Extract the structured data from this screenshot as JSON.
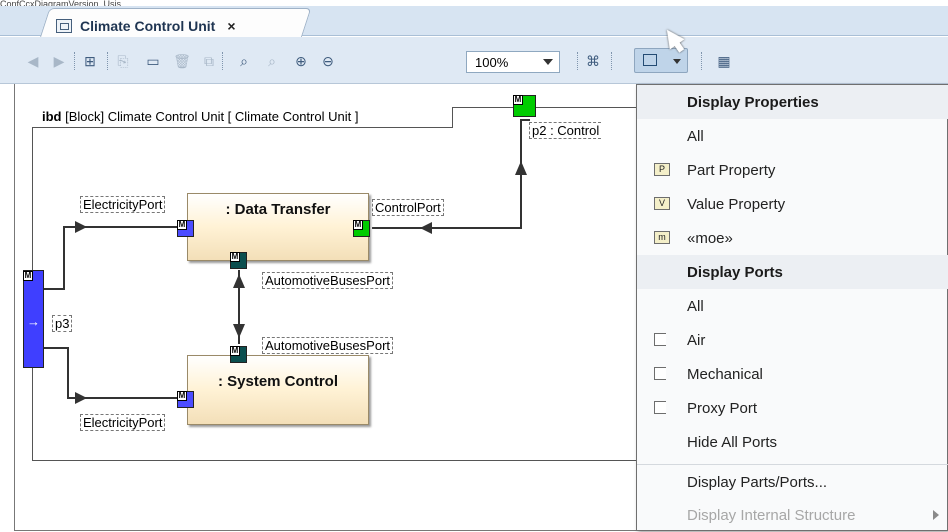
{
  "caption": "ConfCcxDiagramVersion, Usis",
  "tab": {
    "title": "Climate Control Unit",
    "close": "×"
  },
  "toolbar": {
    "zoom": "100%",
    "icons": [
      "back-icon",
      "forward-icon",
      "hierarchy-icon",
      "copy-icon",
      "paste-icon",
      "delete-icon",
      "duplicate-icon",
      "zoom-icon",
      "zoom-fit-icon",
      "zoom-in-icon",
      "zoom-out-icon",
      "layout-icon",
      "display-icon",
      "dropdown-icon",
      "table-icon"
    ]
  },
  "diagram": {
    "frame_kind": "ibd",
    "frame_title": "[Block] Climate Control Unit [ Climate Control Unit ]",
    "blocks": [
      {
        "name": ": Data Transfer"
      },
      {
        "name": ": System Control"
      }
    ],
    "labels": {
      "electricity_top": "ElectricityPort",
      "control_port": "ControlPort",
      "automotive_top": "AutomotiveBusesPort",
      "automotive_bottom": "AutomotiveBusesPort",
      "electricity_bottom": "ElectricityPort",
      "p3": "p3",
      "p2": "p2 : Control"
    },
    "badge": "M"
  },
  "menu": {
    "header1": "Display Properties",
    "item_all_1": "All",
    "part_property": "Part Property",
    "value_property": "Value Property",
    "moe": "«moe»",
    "header2": "Display Ports",
    "item_all_2": "All",
    "air": "Air",
    "mechanical": "Mechanical",
    "proxy_port": "Proxy Port",
    "hide_all_ports": "Hide All Ports",
    "display_parts_ports": "Display Parts/Ports...",
    "display_internal_structure": "Display Internal Structure",
    "icons": {
      "part": "P",
      "value": "V",
      "moe": "m"
    }
  },
  "colors": {
    "accent": "#3f3fff",
    "port_green": "#00cc00",
    "port_dark": "#0b4f4f",
    "block_fill": "#fff2d5"
  }
}
